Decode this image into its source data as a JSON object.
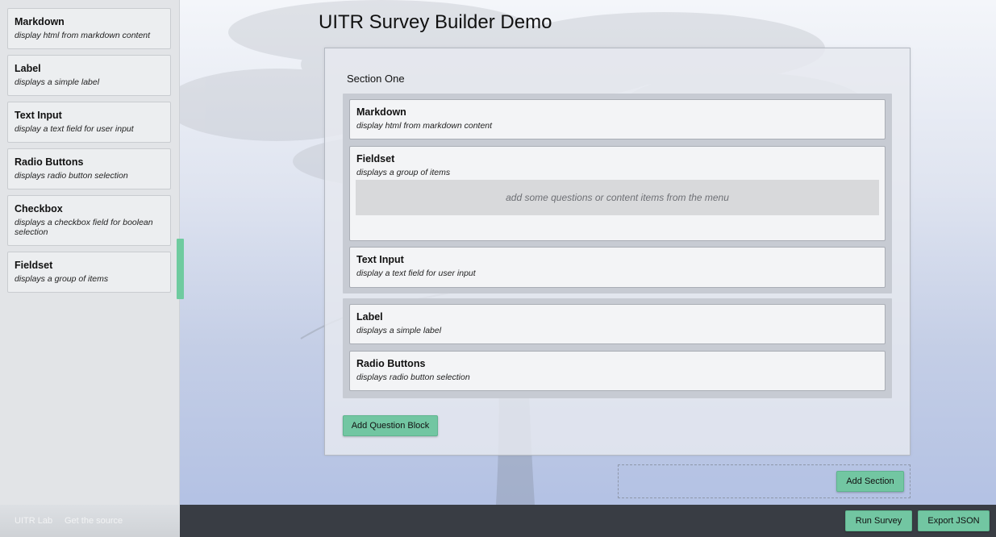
{
  "app": {
    "title": "UITR Survey Builder Demo"
  },
  "palette": {
    "items": [
      {
        "title": "Markdown",
        "desc": "display html from markdown content"
      },
      {
        "title": "Label",
        "desc": "displays a simple label"
      },
      {
        "title": "Text Input",
        "desc": "display a text field for user input"
      },
      {
        "title": "Radio Buttons",
        "desc": "displays radio button selection"
      },
      {
        "title": "Checkbox",
        "desc": "displays a checkbox field for boolean selection"
      },
      {
        "title": "Fieldset",
        "desc": "displays a group of items"
      }
    ]
  },
  "survey": {
    "section": {
      "title": "Section One",
      "blocks": [
        {
          "items": [
            {
              "title": "Markdown",
              "desc": "display html from markdown content"
            },
            {
              "title": "Fieldset",
              "desc": "displays a group of items",
              "placeholder": "add some questions or content items from the menu"
            },
            {
              "title": "Text Input",
              "desc": "display a text field for user input"
            }
          ]
        },
        {
          "items": [
            {
              "title": "Label",
              "desc": "displays a simple label"
            },
            {
              "title": "Radio Buttons",
              "desc": "displays radio button selection"
            }
          ]
        }
      ],
      "add_block_label": "Add Question Block"
    },
    "add_section_label": "Add Section"
  },
  "footer": {
    "links": [
      "UITR Lab",
      "Get the source"
    ],
    "run_label": "Run Survey",
    "export_label": "Export JSON"
  },
  "colors": {
    "accent": "#72c6a2",
    "footer_bg": "#393d44"
  }
}
